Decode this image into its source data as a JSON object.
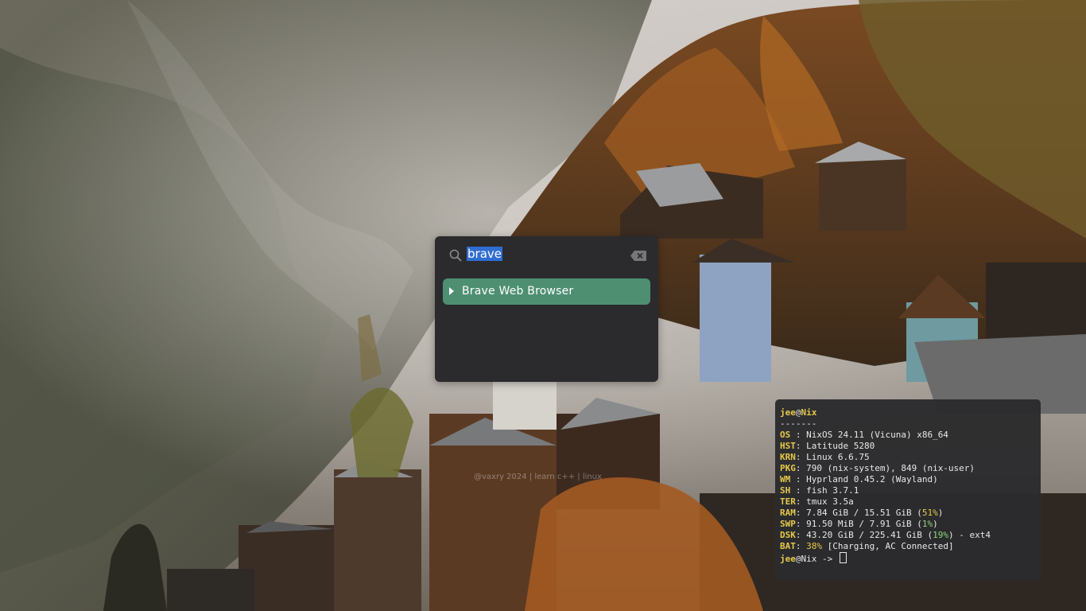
{
  "launcher": {
    "search_query": "brave",
    "results": [
      {
        "label": "Brave Web Browser"
      }
    ]
  },
  "watermark": "@vaxry 2024 | learn c++ | linux",
  "terminal": {
    "user": "jee",
    "host": "Nix",
    "separator": "-------",
    "info": [
      {
        "key": "OS",
        "value": "NixOS 24.11 (Vicuna) x86_64"
      },
      {
        "key": "HST",
        "value": "Latitude 5280"
      },
      {
        "key": "KRN",
        "value": "Linux 6.6.75"
      },
      {
        "key": "PKG",
        "value": "790 (nix-system), 849 (nix-user)"
      },
      {
        "key": "WM",
        "value": "Hyprland 0.45.2 (Wayland)"
      },
      {
        "key": "SH",
        "value": "fish 3.7.1"
      },
      {
        "key": "TER",
        "value": "tmux 3.5a"
      }
    ],
    "ram": {
      "key": "RAM",
      "used": "7.84 GiB",
      "total": "15.51 GiB",
      "percent": "51%"
    },
    "swp": {
      "key": "SWP",
      "used": "91.50 MiB",
      "total": "7.91 GiB",
      "percent": "1%"
    },
    "dsk": {
      "key": "DSK",
      "used": "43.20 GiB",
      "total": "225.41 GiB",
      "percent": "19%",
      "fs": "ext4"
    },
    "bat": {
      "key": "BAT",
      "percent": "38%",
      "status": "[Charging, AC Connected]"
    },
    "prompt_arrow": "->"
  }
}
